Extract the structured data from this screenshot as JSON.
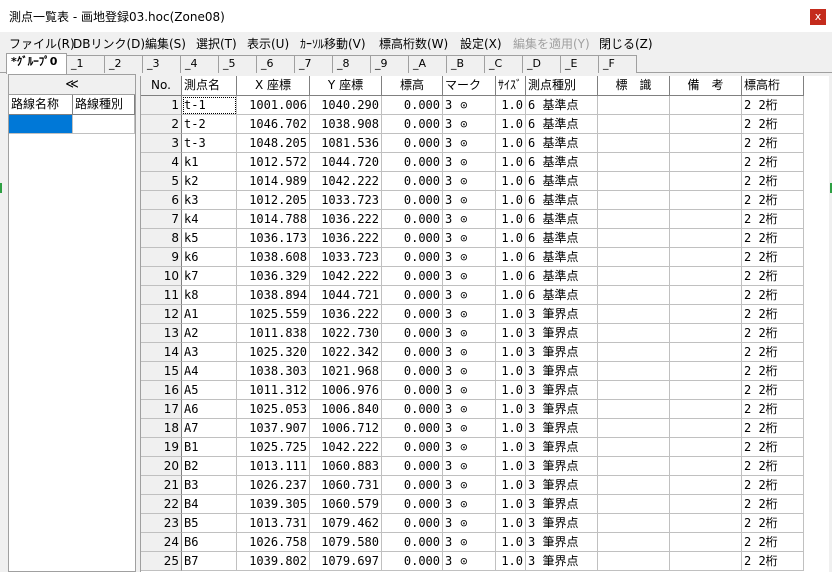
{
  "window": {
    "title": "測点一覧表 - 画地登録03.hoc(Zone08)",
    "close_label": "x"
  },
  "menu": [
    {
      "label": "ファイル(R)",
      "disabled": false
    },
    {
      "label": "DBリンク(D)",
      "disabled": false
    },
    {
      "label": "編集(S)",
      "disabled": false
    },
    {
      "label": "選択(T)",
      "disabled": false
    },
    {
      "label": "表示(U)",
      "disabled": false
    },
    {
      "label": "ｶｰｿﾙ移動(V)",
      "disabled": false
    },
    {
      "label": "標高桁数(W)",
      "disabled": false
    },
    {
      "label": "設定(X)",
      "disabled": false
    },
    {
      "label": "編集を適用(Y)",
      "disabled": true
    },
    {
      "label": "閉じる(Z)",
      "disabled": false
    }
  ],
  "tabs": [
    "*ｸﾞﾙｰﾌﾟ0",
    "_1",
    "_2",
    "_3",
    "_4",
    "_5",
    "_6",
    "_7",
    "_8",
    "_9",
    "_A",
    "_B",
    "_C",
    "_D",
    "_E",
    "_F"
  ],
  "active_tab": 0,
  "left_pane": {
    "collapse_label": "≪",
    "headers": [
      "路線名称",
      "路線種別"
    ]
  },
  "grid": {
    "headers": [
      "No.",
      "測点名",
      "X 座標",
      "Y 座標",
      "標高",
      "マーク",
      "ｻｲｽﾞ",
      "測点種別",
      "標　識",
      "備　考",
      "標高桁"
    ],
    "mark_symbol": "⊙",
    "rows": [
      [
        "1",
        "t-1",
        "1001.006",
        "1040.290",
        "0.000",
        "3",
        "1.0",
        "6 基準点",
        "",
        "",
        "2 2桁"
      ],
      [
        "2",
        "t-2",
        "1046.702",
        "1038.908",
        "0.000",
        "3",
        "1.0",
        "6 基準点",
        "",
        "",
        "2 2桁"
      ],
      [
        "3",
        "t-3",
        "1048.205",
        "1081.536",
        "0.000",
        "3",
        "1.0",
        "6 基準点",
        "",
        "",
        "2 2桁"
      ],
      [
        "4",
        "k1",
        "1012.572",
        "1044.720",
        "0.000",
        "3",
        "1.0",
        "6 基準点",
        "",
        "",
        "2 2桁"
      ],
      [
        "5",
        "k2",
        "1014.989",
        "1042.222",
        "0.000",
        "3",
        "1.0",
        "6 基準点",
        "",
        "",
        "2 2桁"
      ],
      [
        "6",
        "k3",
        "1012.205",
        "1033.723",
        "0.000",
        "3",
        "1.0",
        "6 基準点",
        "",
        "",
        "2 2桁"
      ],
      [
        "7",
        "k4",
        "1014.788",
        "1036.222",
        "0.000",
        "3",
        "1.0",
        "6 基準点",
        "",
        "",
        "2 2桁"
      ],
      [
        "8",
        "k5",
        "1036.173",
        "1036.222",
        "0.000",
        "3",
        "1.0",
        "6 基準点",
        "",
        "",
        "2 2桁"
      ],
      [
        "9",
        "k6",
        "1038.608",
        "1033.723",
        "0.000",
        "3",
        "1.0",
        "6 基準点",
        "",
        "",
        "2 2桁"
      ],
      [
        "10",
        "k7",
        "1036.329",
        "1042.222",
        "0.000",
        "3",
        "1.0",
        "6 基準点",
        "",
        "",
        "2 2桁"
      ],
      [
        "11",
        "k8",
        "1038.894",
        "1044.721",
        "0.000",
        "3",
        "1.0",
        "6 基準点",
        "",
        "",
        "2 2桁"
      ],
      [
        "12",
        "A1",
        "1025.559",
        "1036.222",
        "0.000",
        "3",
        "1.0",
        "3 筆界点",
        "",
        "",
        "2 2桁"
      ],
      [
        "13",
        "A2",
        "1011.838",
        "1022.730",
        "0.000",
        "3",
        "1.0",
        "3 筆界点",
        "",
        "",
        "2 2桁"
      ],
      [
        "14",
        "A3",
        "1025.320",
        "1022.342",
        "0.000",
        "3",
        "1.0",
        "3 筆界点",
        "",
        "",
        "2 2桁"
      ],
      [
        "15",
        "A4",
        "1038.303",
        "1021.968",
        "0.000",
        "3",
        "1.0",
        "3 筆界点",
        "",
        "",
        "2 2桁"
      ],
      [
        "16",
        "A5",
        "1011.312",
        "1006.976",
        "0.000",
        "3",
        "1.0",
        "3 筆界点",
        "",
        "",
        "2 2桁"
      ],
      [
        "17",
        "A6",
        "1025.053",
        "1006.840",
        "0.000",
        "3",
        "1.0",
        "3 筆界点",
        "",
        "",
        "2 2桁"
      ],
      [
        "18",
        "A7",
        "1037.907",
        "1006.712",
        "0.000",
        "3",
        "1.0",
        "3 筆界点",
        "",
        "",
        "2 2桁"
      ],
      [
        "19",
        "B1",
        "1025.725",
        "1042.222",
        "0.000",
        "3",
        "1.0",
        "3 筆界点",
        "",
        "",
        "2 2桁"
      ],
      [
        "20",
        "B2",
        "1013.111",
        "1060.883",
        "0.000",
        "3",
        "1.0",
        "3 筆界点",
        "",
        "",
        "2 2桁"
      ],
      [
        "21",
        "B3",
        "1026.237",
        "1060.731",
        "0.000",
        "3",
        "1.0",
        "3 筆界点",
        "",
        "",
        "2 2桁"
      ],
      [
        "22",
        "B4",
        "1039.305",
        "1060.579",
        "0.000",
        "3",
        "1.0",
        "3 筆界点",
        "",
        "",
        "2 2桁"
      ],
      [
        "23",
        "B5",
        "1013.731",
        "1079.462",
        "0.000",
        "3",
        "1.0",
        "3 筆界点",
        "",
        "",
        "2 2桁"
      ],
      [
        "24",
        "B6",
        "1026.758",
        "1079.580",
        "0.000",
        "3",
        "1.0",
        "3 筆界点",
        "",
        "",
        "2 2桁"
      ],
      [
        "25",
        "B7",
        "1039.802",
        "1079.697",
        "0.000",
        "3",
        "1.0",
        "3 筆界点",
        "",
        "",
        "2 2桁"
      ]
    ]
  },
  "colors": {
    "selection": "#0078d7",
    "close_button": "#c42b1c",
    "chrome": "#f0f0f0"
  }
}
